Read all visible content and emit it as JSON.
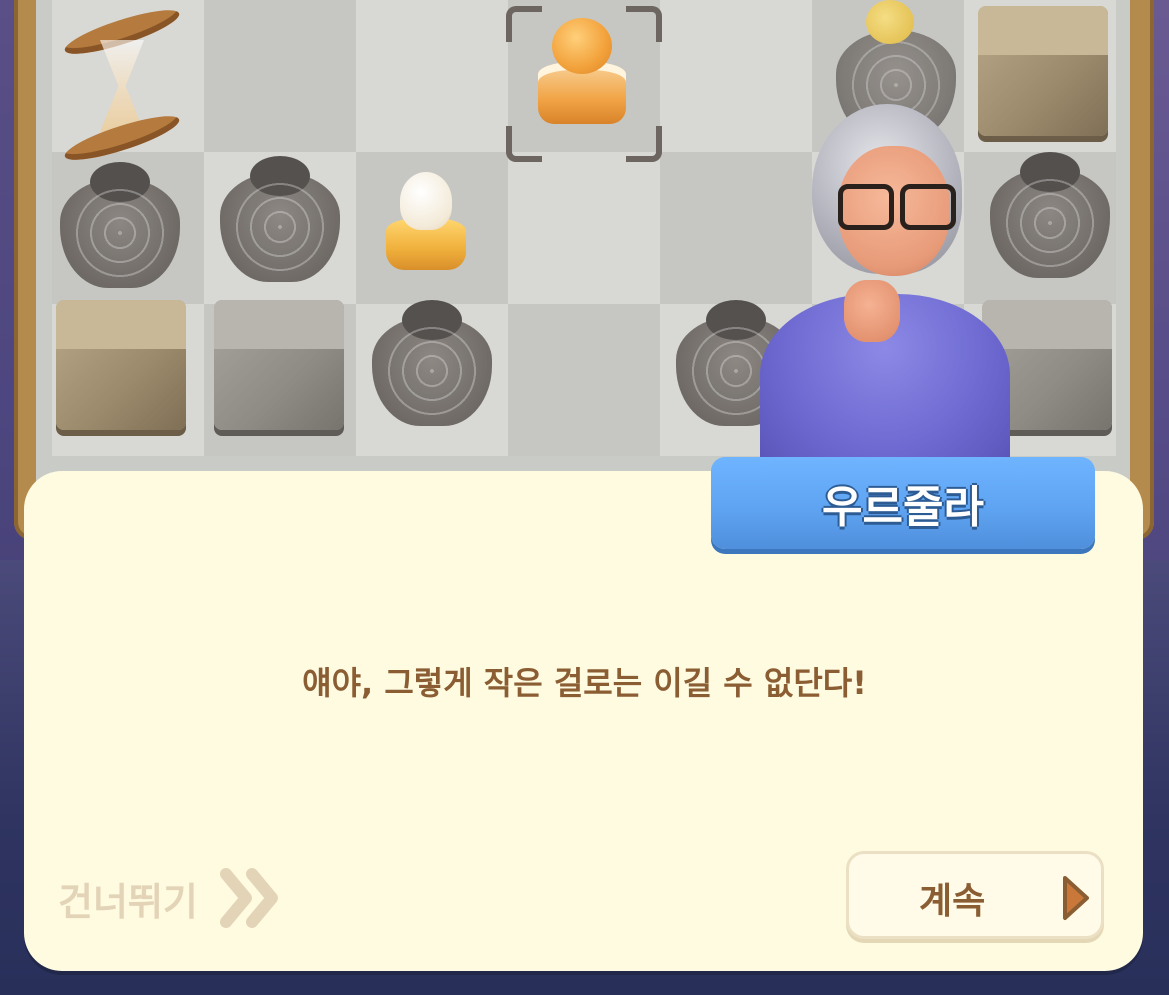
{
  "speaker": {
    "name": "우르줄라"
  },
  "dialog": {
    "message": "얘야, 그렇게 작은 걸로는 이길 수 없단다!"
  },
  "controls": {
    "skip_label": "건너뛰기",
    "continue_label": "계속"
  },
  "icons": {
    "skip": "double-chevron-right-icon",
    "continue": "play-triangle-icon",
    "selection": "selection-corners-icon"
  },
  "colors": {
    "dialog_bg": "#fefbe1",
    "name_tag": "#5fa4f2",
    "text_brown": "#8b5d33",
    "skip_tan": "#e3d4b8",
    "continue_arrow": "#c9783a"
  }
}
